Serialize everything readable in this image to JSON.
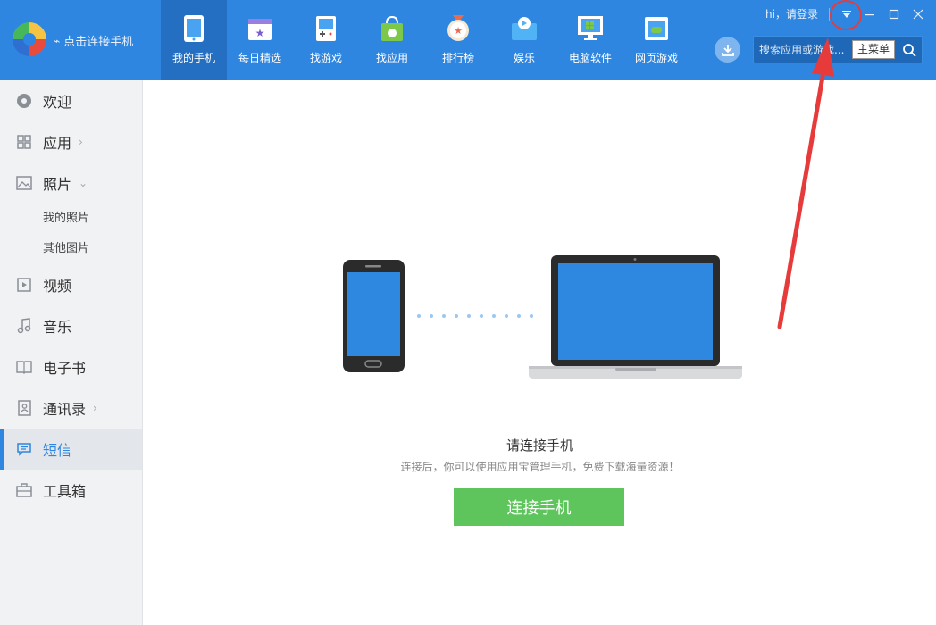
{
  "app": {
    "connect_link": "点击连接手机"
  },
  "nav": [
    {
      "label": "我的手机",
      "icon": "phone-icon"
    },
    {
      "label": "每日精选",
      "icon": "calendar-star-icon"
    },
    {
      "label": "找游戏",
      "icon": "gamepad-icon"
    },
    {
      "label": "找应用",
      "icon": "android-bag-icon"
    },
    {
      "label": "排行榜",
      "icon": "medal-icon"
    },
    {
      "label": "娱乐",
      "icon": "video-play-icon"
    },
    {
      "label": "电脑软件",
      "icon": "monitor-windows-icon"
    },
    {
      "label": "网页游戏",
      "icon": "web-game-icon"
    }
  ],
  "header": {
    "greeting": "hi，请登录",
    "search_placeholder": "搜索应用或游戏...",
    "main_menu": "主菜单"
  },
  "sidebar": {
    "items": [
      {
        "label": "欢迎",
        "icon": "welcome-icon"
      },
      {
        "label": "应用",
        "icon": "grid-icon",
        "chevron": "›"
      },
      {
        "label": "照片",
        "icon": "image-icon",
        "chevron": "⌄"
      },
      {
        "label": "视频",
        "icon": "video-icon"
      },
      {
        "label": "音乐",
        "icon": "music-note-icon"
      },
      {
        "label": "电子书",
        "icon": "book-icon"
      },
      {
        "label": "通讯录",
        "icon": "contacts-icon",
        "chevron": "›"
      },
      {
        "label": "短信",
        "icon": "sms-icon"
      },
      {
        "label": "工具箱",
        "icon": "toolbox-icon"
      }
    ],
    "photo_subitems": [
      "我的照片",
      "其他图片"
    ],
    "active": "短信"
  },
  "main": {
    "title": "请连接手机",
    "subtitle": "连接后，你可以使用应用宝管理手机，免费下载海量资源！",
    "connect_button": "连接手机"
  },
  "colors": {
    "topbar": "#2f86e0",
    "nav_active": "#256fc2",
    "accent": "#2f86e0",
    "button_green": "#5dc55c",
    "annotation_red": "#e73b3b"
  }
}
